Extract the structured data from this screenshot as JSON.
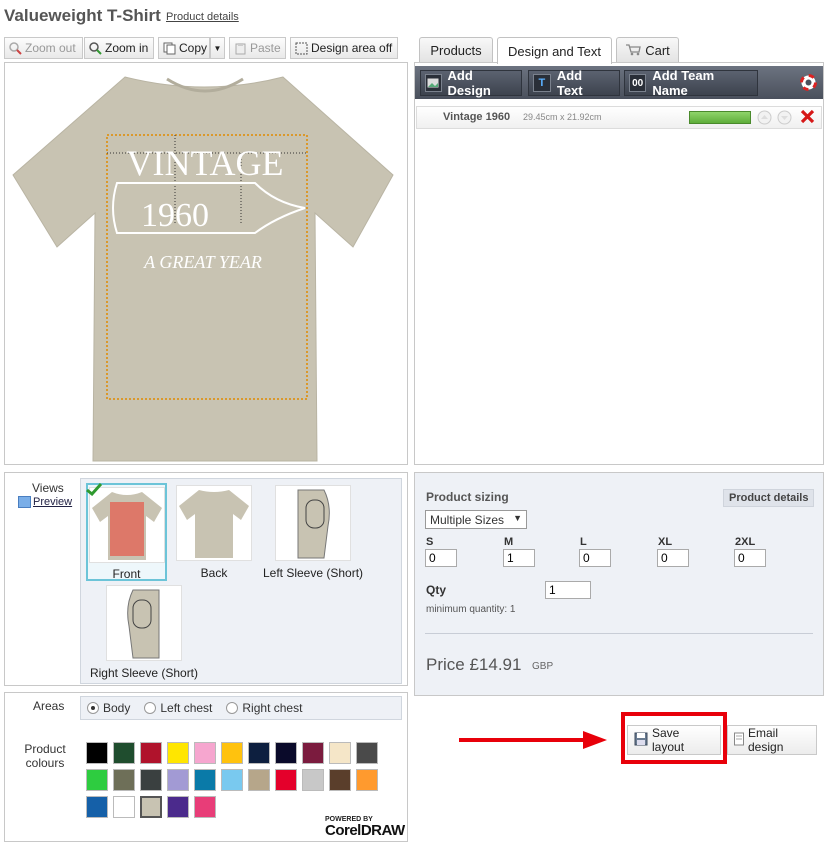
{
  "header": {
    "title": "Valueweight T-Shirt",
    "product_details_link": "Product details"
  },
  "toolbar": {
    "zoom_out": "Zoom out",
    "zoom_in": "Zoom in",
    "copy": "Copy",
    "paste": "Paste",
    "design_area_off": "Design area off"
  },
  "tabs": {
    "products": "Products",
    "design_and_text": "Design and Text",
    "cart": "Cart"
  },
  "design_toolbar": {
    "add_design": "Add Design",
    "add_text": "Add Text",
    "add_team_name": "Add Team Name",
    "team_icon_text": "00"
  },
  "layer": {
    "name": "Vintage 1960",
    "dimensions": "29.45cm x 21.92cm"
  },
  "artwork": {
    "line1": "VINTAGE",
    "line2": "1960",
    "line3": "A GREAT YEAR"
  },
  "views": {
    "label": "Views",
    "preview_link": "Preview",
    "items": [
      {
        "label": "Front"
      },
      {
        "label": "Back"
      },
      {
        "label": "Left Sleeve (Short)"
      },
      {
        "label": "Right Sleeve (Short)"
      }
    ]
  },
  "areas": {
    "label": "Areas",
    "options": [
      "Body",
      "Left chest",
      "Right chest"
    ],
    "selected": "Body"
  },
  "colours": {
    "label_line1": "Product",
    "label_line2": "colours",
    "swatches": [
      "#000000",
      "#1f4d2e",
      "#b0132c",
      "#ffe600",
      "#f6a6cf",
      "#ffc20e",
      "#0d1f3f",
      "#0a0a2a",
      "#7b1b3e",
      "#f5e6c8",
      "#4a4a4a",
      "#2ecc40",
      "#6e6f58",
      "#3a4040",
      "#a29ad4",
      "#0a7aa8",
      "#79c9ef",
      "#b6a68a",
      "#e4002b",
      "#c8c8c8",
      "#5a3e2b",
      "#ff9a2e",
      "#1560a8",
      "#ffffff",
      "#c8c3b2",
      "#4b2a8c",
      "#e83d78"
    ],
    "selected_index": 24
  },
  "branding": {
    "powered_by": "POWERED BY",
    "brand": "CorelDRAW"
  },
  "sizing": {
    "title": "Product sizing",
    "details_button": "Product details",
    "mode": "Multiple Sizes",
    "sizes": [
      {
        "label": "S",
        "value": "0"
      },
      {
        "label": "M",
        "value": "1"
      },
      {
        "label": "L",
        "value": "0"
      },
      {
        "label": "XL",
        "value": "0"
      },
      {
        "label": "2XL",
        "value": "0"
      }
    ],
    "qty_label": "Qty",
    "qty_value": "1",
    "min_qty": "minimum quantity: 1",
    "price": "Price £14.91",
    "currency": "GBP"
  },
  "actions": {
    "save_layout": "Save layout",
    "email_design": "Email design"
  },
  "colors": {
    "accent_red": "#e8000a",
    "shirt": "#c8c3b2",
    "bar_green": "#6cc04a"
  }
}
